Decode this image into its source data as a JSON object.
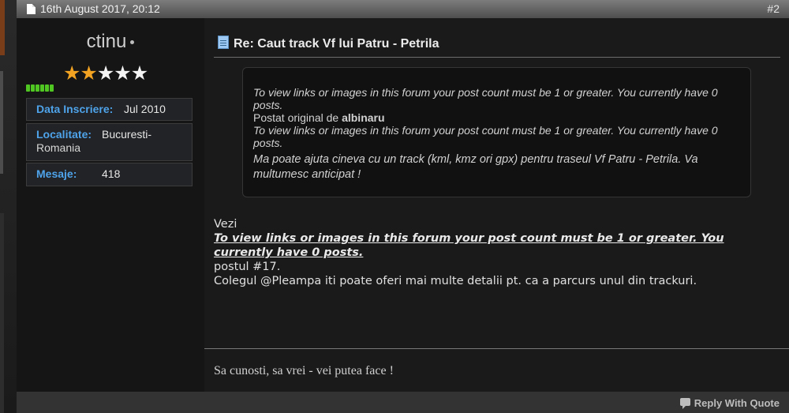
{
  "post": {
    "date": "16th August 2017, 20:12",
    "number": "#2",
    "title": "Re: Caut track Vf lui Patru - Petrila"
  },
  "user": {
    "name": "ctinu",
    "rating_stars": 2,
    "rating_max": 5,
    "reputation_pips": 6,
    "fields": {
      "join_label": "Data Inscriere:",
      "join_value": "Jul 2010",
      "location_label": "Localitate:",
      "location_value_line1": "Bucuresti-",
      "location_value_line2": "Romania",
      "messages_label": "Mesaje:",
      "messages_value": "418"
    }
  },
  "quote": {
    "restricted_1": "To view links or images in this forum your post count must be 1 or greater. You currently have 0 posts.",
    "posted_by_prefix": "Postat original de",
    "author": "albinaru",
    "restricted_2": "To view links or images in this forum your post count must be 1 or greater. You currently have 0 posts.",
    "message": "Ma poate ajuta cineva cu un track (kml, kmz ori gpx) pentru traseul Vf Patru - Petrila. Va multumesc anticipat !"
  },
  "body": {
    "line1": "Vezi",
    "restricted": "To view links or images in this forum your post count must be 1 or greater. You currently have 0 posts.",
    "line2": "postul #17.",
    "line3": "Colegul @Pleampa iti poate oferi mai multe detalii pt. ca a parcurs unul din trackuri."
  },
  "signature": "Sa cunosti, sa vrei - vei putea face !",
  "footer": {
    "reply_label": "Reply With Quote"
  },
  "icons": {
    "header": "document-icon",
    "title": "post-document-icon",
    "reply": "speech-bubble-icon"
  },
  "colors": {
    "accent_blue": "#4ea3ea",
    "star_gold": "#f2a322",
    "rep_green": "#4fc621"
  }
}
